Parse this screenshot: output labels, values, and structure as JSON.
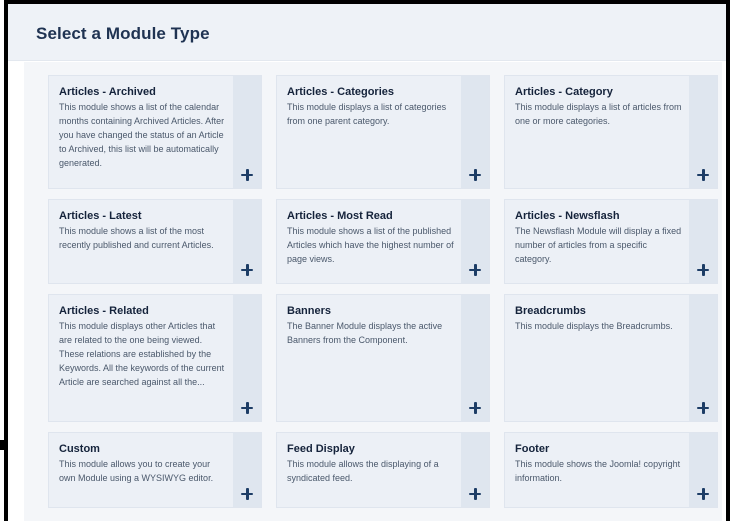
{
  "header": {
    "title": "Select a Module Type"
  },
  "modules": [
    {
      "title": "Articles - Archived",
      "description": "This module shows a list of the calendar months containing Archived Articles. After you have changed the status of an Article to Archived, this list will be automatically generated.",
      "icon": "plus-icon"
    },
    {
      "title": "Articles - Categories",
      "description": "This module displays a list of categories from one parent category.",
      "icon": "plus-icon"
    },
    {
      "title": "Articles - Category",
      "description": "This module displays a list of articles from one or more categories.",
      "icon": "plus-icon"
    },
    {
      "title": "Articles - Latest",
      "description": "This module shows a list of the most recently published and current Articles.",
      "icon": "plus-icon"
    },
    {
      "title": "Articles - Most Read",
      "description": "This module shows a list of the published Articles which have the highest number of page views.",
      "icon": "plus-icon"
    },
    {
      "title": "Articles - Newsflash",
      "description": "The Newsflash Module will display a fixed number of articles from a specific category.",
      "icon": "plus-icon"
    },
    {
      "title": "Articles - Related",
      "description": "This module displays other Articles that are related to the one being viewed. These relations are established by the Keywords. All the keywords of the current Article are searched against all the...",
      "icon": "plus-icon"
    },
    {
      "title": "Banners",
      "description": "The Banner Module displays the active Banners from the Component.",
      "icon": "plus-icon"
    },
    {
      "title": "Breadcrumbs",
      "description": "This module displays the Breadcrumbs.",
      "icon": "plus-icon"
    },
    {
      "title": "Custom",
      "description": "This module allows you to create your own Module using a WYSIWYG editor.",
      "icon": "plus-icon"
    },
    {
      "title": "Feed Display",
      "description": "This module allows the displaying of a syndicated feed.",
      "icon": "plus-icon"
    },
    {
      "title": "Footer",
      "description": "This module shows the Joomla! copyright information.",
      "icon": "plus-icon"
    }
  ]
}
